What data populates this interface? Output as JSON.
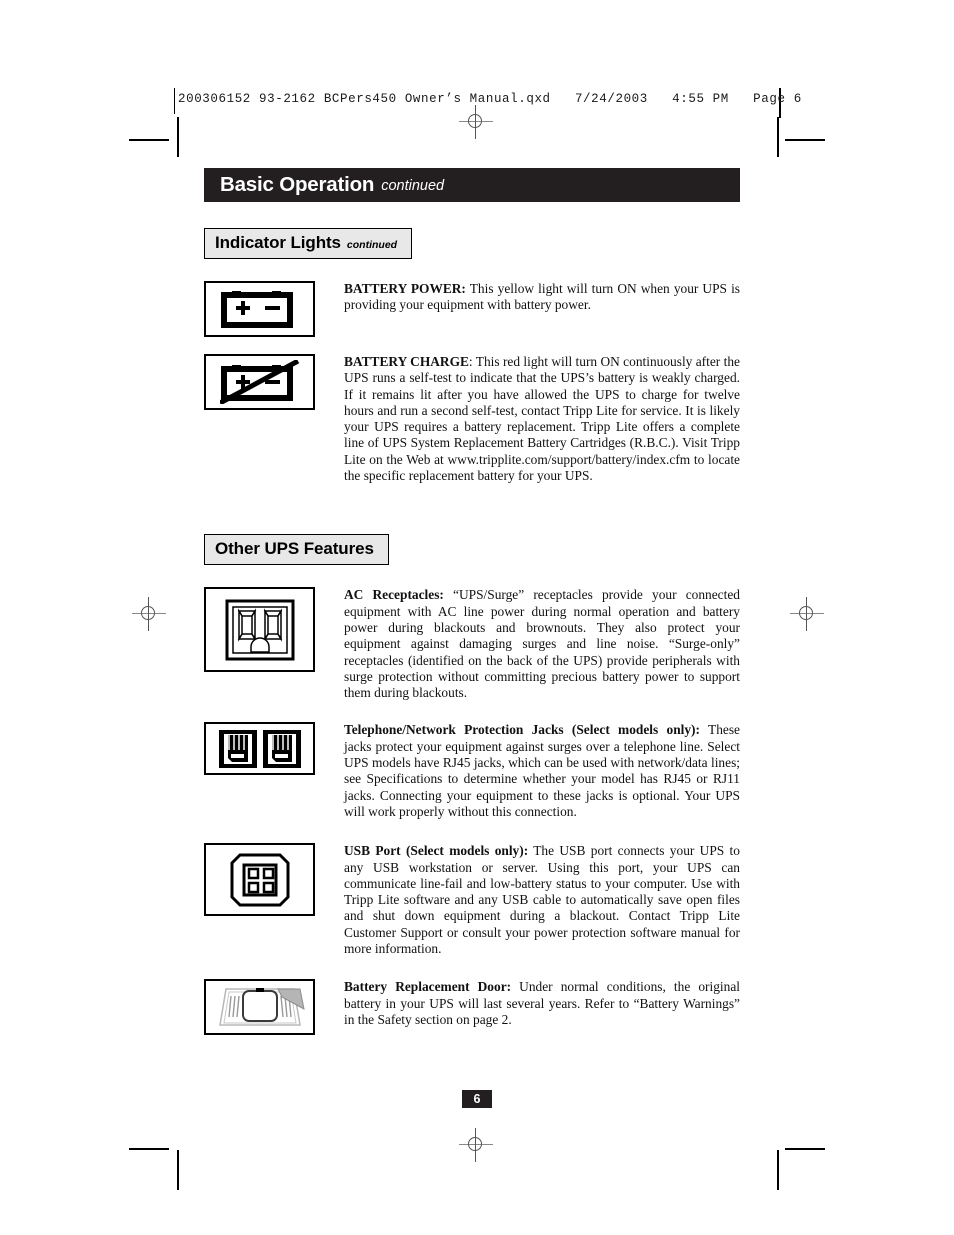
{
  "prepress": {
    "file_header": "200306152 93-2162 BCPers450 Owner’s Manual.qxd   7/24/2003   4:55 PM   Page 6"
  },
  "title_bar": {
    "title": "Basic Operation",
    "continued": "continued"
  },
  "sections": [
    {
      "id": "indicator-lights",
      "heading": "Indicator Lights",
      "heading_suffix": "continued",
      "items": [
        {
          "id": "battery-power",
          "icon": "battery-icon",
          "lead": "BATTERY POWER:",
          "body": " This yellow light will turn ON when your UPS is providing your equipment with battery power."
        },
        {
          "id": "battery-charge",
          "icon": "battery-slashed-icon",
          "lead": "BATTERY CHARGE",
          "body": ": This red light will turn ON continuously after the UPS runs a self-test to indicate that the UPS’s battery is weakly charged. If it remains lit after you have allowed the UPS to charge for twelve hours and run a second self-test, contact Tripp Lite for service. It is likely your UPS requires a battery replacement. Tripp Lite offers a complete line of UPS System Replacement Battery Cartridges (R.B.C.). Visit Tripp Lite on the Web at www.tripplite.com/support/battery/index.cfm to locate the specific replacement battery for your UPS."
        }
      ]
    },
    {
      "id": "other-ups-features",
      "heading": "Other UPS Features",
      "heading_suffix": "",
      "items": [
        {
          "id": "ac-receptacles",
          "icon": "ac-receptacle-icon",
          "lead": "AC Receptacles:",
          "body": " “UPS/Surge” receptacles provide your connected equipment with AC line power during normal operation and battery power during blackouts and brownouts. They also protect your equipment against damaging surges and line noise. “Surge-only” receptacles (identified on the back of the UPS) provide peripherals with surge protection without committing precious battery power to support them during blackouts."
        },
        {
          "id": "telephone-network-jacks",
          "icon": "rj-jacks-icon",
          "lead": "Telephone/Network Protection Jacks (Select models only):",
          "body": " These jacks protect your equipment against surges over a telephone line. Select UPS models have RJ45 jacks, which can be used with network/data lines; see Specifications to determine whether your model has RJ45 or RJ11 jacks. Connecting your equipment to these jacks is optional. Your UPS will work properly without this connection."
        },
        {
          "id": "usb-port",
          "icon": "usb-port-icon",
          "lead": "USB Port (Select models only):",
          "body": " The USB port connects your UPS to any USB workstation or server. Using this port, your UPS can communicate line-fail and low-battery status to your computer. Use with Tripp Lite software and any USB cable to automatically save open files and shut down equipment during a blackout. Contact Tripp Lite Customer Support or consult your power protection software manual for more information."
        },
        {
          "id": "battery-replacement-door",
          "icon": "battery-door-icon",
          "lead": "Battery Replacement Door:",
          "body": " Under normal conditions, the original battery in your UPS will last several years. Refer to “Battery Warnings” in the Safety section on page 2."
        }
      ]
    }
  ],
  "footer": {
    "page_number": "6"
  }
}
